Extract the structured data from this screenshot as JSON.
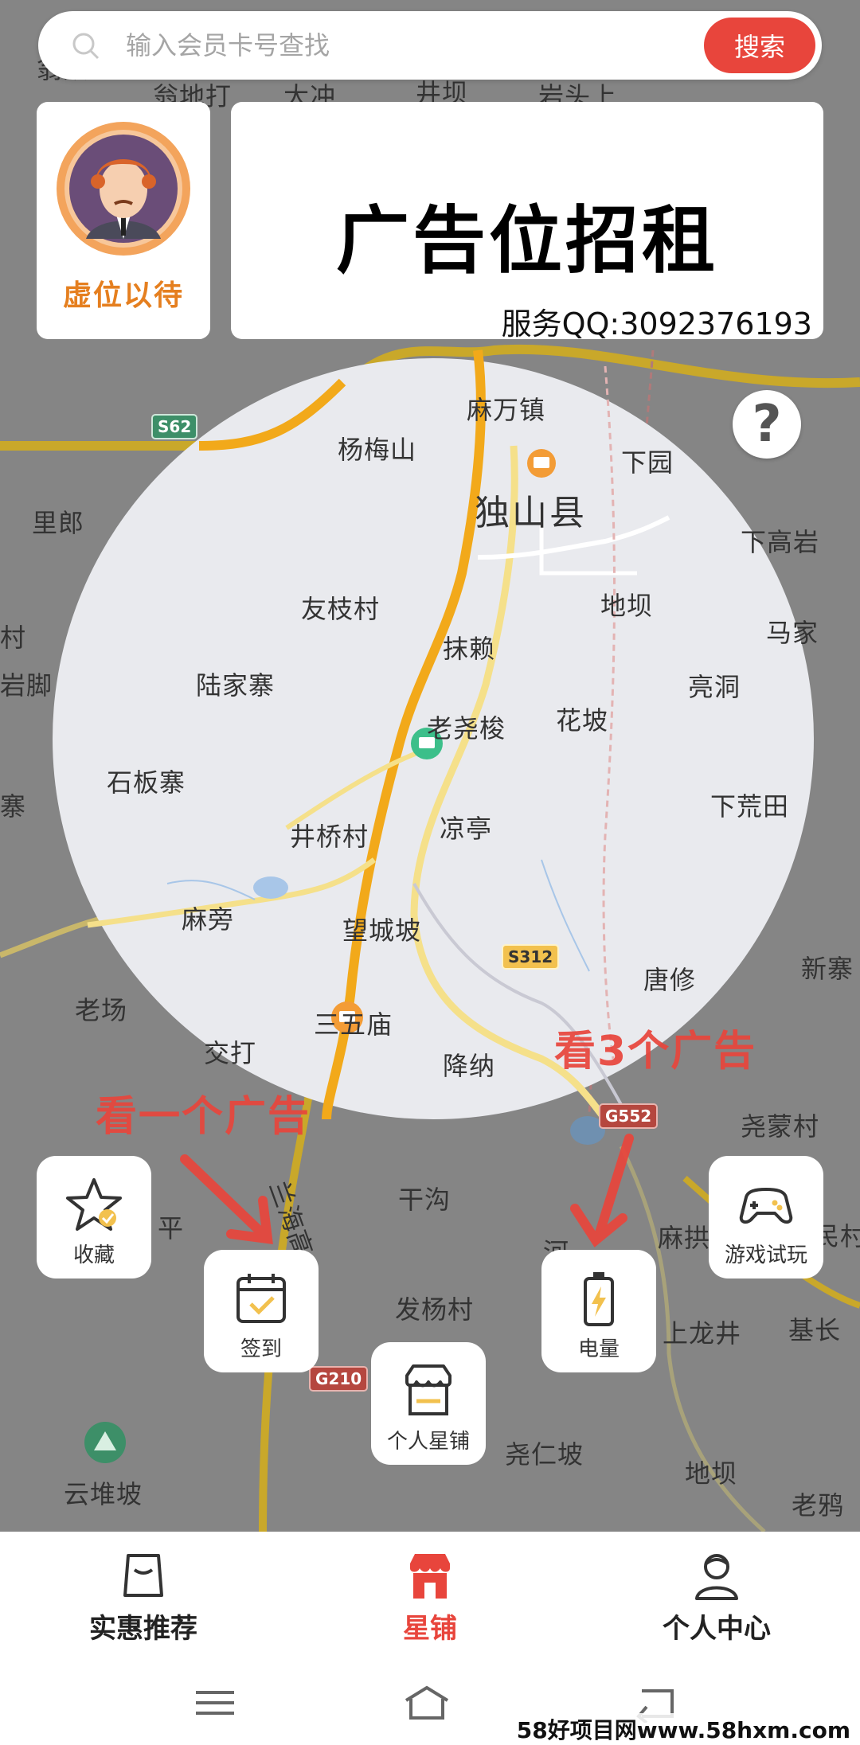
{
  "search": {
    "placeholder": "输入会员卡号查找",
    "button_label": "搜索"
  },
  "avatar_card": {
    "label": "虚位以待"
  },
  "ad_card": {
    "title": "广告位招租",
    "contact": "服务QQ:3092376193"
  },
  "help": {
    "label": "?"
  },
  "map": {
    "county": "独山县",
    "places": [
      "麻万镇",
      "杨梅山",
      "下园",
      "里郎",
      "下高岩",
      "友枝村",
      "地坝",
      "马家",
      "抹赖",
      "陆家寨",
      "亮洞",
      "老尧梭",
      "花坡",
      "石板寨",
      "下荒田",
      "井桥村",
      "凉亭",
      "麻旁",
      "望城坡",
      "新寨",
      "唐修",
      "老场",
      "三五庙",
      "交打",
      "降纳",
      "尧蒙村",
      "干沟",
      "麻拱",
      "发杨村",
      "上龙井",
      "基长",
      "尧仁坡",
      "地坝",
      "老鸦",
      "云堆坡",
      "村",
      "岩脚",
      "寨",
      "兰海高",
      "平",
      "河",
      "民村"
    ],
    "top_fragments": [
      "翁众",
      "翁地打",
      "大冲",
      "井坝",
      "岩头上"
    ],
    "road_badges": [
      "S62",
      "S312",
      "G552",
      "G210"
    ]
  },
  "annotations": {
    "one_ad": "看一个广告",
    "three_ads": "看3个广告"
  },
  "tiles": {
    "favorite": "收藏",
    "checkin": "签到",
    "power": "电量",
    "game": "游戏试玩",
    "shop": "个人星铺"
  },
  "bottom_nav": {
    "items": [
      {
        "label": "实惠推荐",
        "icon": "bag-icon"
      },
      {
        "label": "星铺",
        "icon": "store-icon",
        "active": true
      },
      {
        "label": "个人中心",
        "icon": "user-icon"
      }
    ]
  },
  "system_bar": {
    "buttons": [
      "menu-icon",
      "home-icon",
      "back-icon"
    ]
  },
  "watermark": "58好项目网www.58hxm.com",
  "colors": {
    "accent": "#e8453c",
    "avatar_label": "#e57f1f",
    "active_nav": "#e8453c"
  }
}
